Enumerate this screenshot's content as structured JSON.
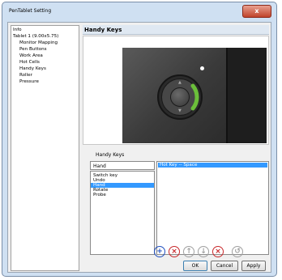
{
  "window": {
    "title": "PenTablet Setting",
    "close_glyph": "x"
  },
  "tree": {
    "items": [
      {
        "label": "Info",
        "level": 0
      },
      {
        "label": "Tablet 1 (9.00x5.75)",
        "level": 0
      },
      {
        "label": "Monitor Mapping",
        "level": 1
      },
      {
        "label": "Pen Buttons",
        "level": 1
      },
      {
        "label": "Work Area",
        "level": 1
      },
      {
        "label": "Hot Cells",
        "level": 1
      },
      {
        "label": "Handy Keys",
        "level": 1
      },
      {
        "label": "Roller",
        "level": 1
      },
      {
        "label": "Pressure",
        "level": 1
      }
    ]
  },
  "panel": {
    "title": "Handy Keys"
  },
  "handy_keys": {
    "group_label": "Handy Keys",
    "selected_key": "Hand",
    "options": [
      "Switch key",
      "Undo",
      "Hand",
      "Rotate",
      "Probe"
    ],
    "selected_index": 2,
    "assigned": [
      "Hot Key -- Space"
    ]
  },
  "toolbar": {
    "icons": [
      {
        "name": "add-icon",
        "glyph": "+",
        "color": "#1f4fbf",
        "enabled": true
      },
      {
        "name": "delete-icon",
        "glyph": "×",
        "color": "#c8282b",
        "enabled": true
      },
      {
        "name": "move-up-icon",
        "glyph": "↑",
        "color": "#a0a0a0",
        "enabled": false
      },
      {
        "name": "move-down-icon",
        "glyph": "↓",
        "color": "#a0a0a0",
        "enabled": false
      },
      {
        "name": "clear-icon",
        "glyph": "×",
        "color": "#c8282b",
        "enabled": true
      },
      {
        "name": "reset-icon",
        "glyph": "↺",
        "color": "#a0a0a0",
        "enabled": false
      }
    ]
  },
  "buttons": {
    "ok": "OK",
    "cancel": "Cancel",
    "apply": "Apply"
  }
}
